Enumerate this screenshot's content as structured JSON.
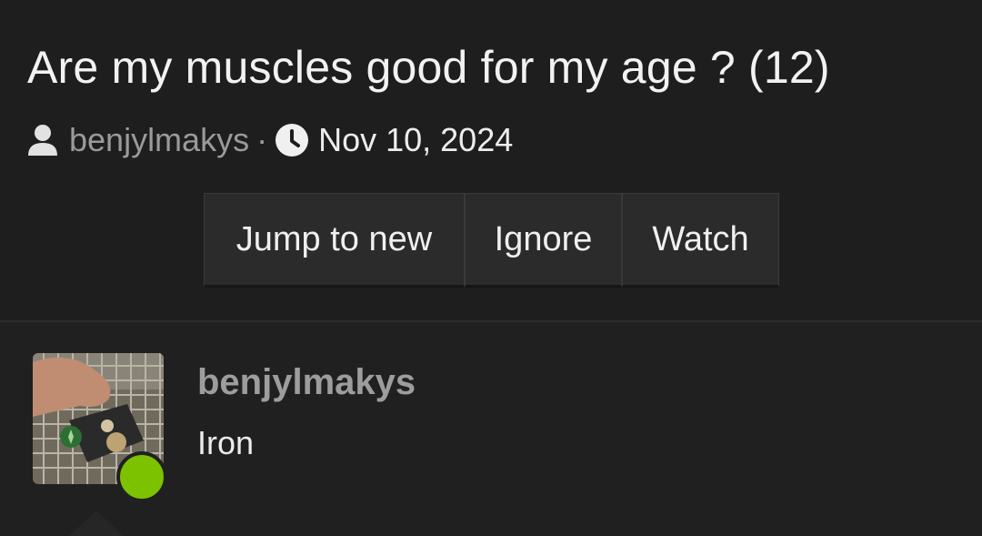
{
  "thread": {
    "title": "Are my muscles good for my age ? (12)",
    "author": "benjylmakys",
    "separator": "·",
    "date": "Nov 10, 2024"
  },
  "actions": {
    "jump_label": "Jump to new",
    "ignore_label": "Ignore",
    "watch_label": "Watch"
  },
  "post": {
    "author": "benjylmakys",
    "text": "Iron",
    "online": true
  },
  "icons": {
    "user": "user-icon",
    "clock": "clock-icon"
  },
  "colors": {
    "background": "#1f1f1f",
    "online_indicator": "#7cc200",
    "muted_text": "#9a9a9a"
  }
}
